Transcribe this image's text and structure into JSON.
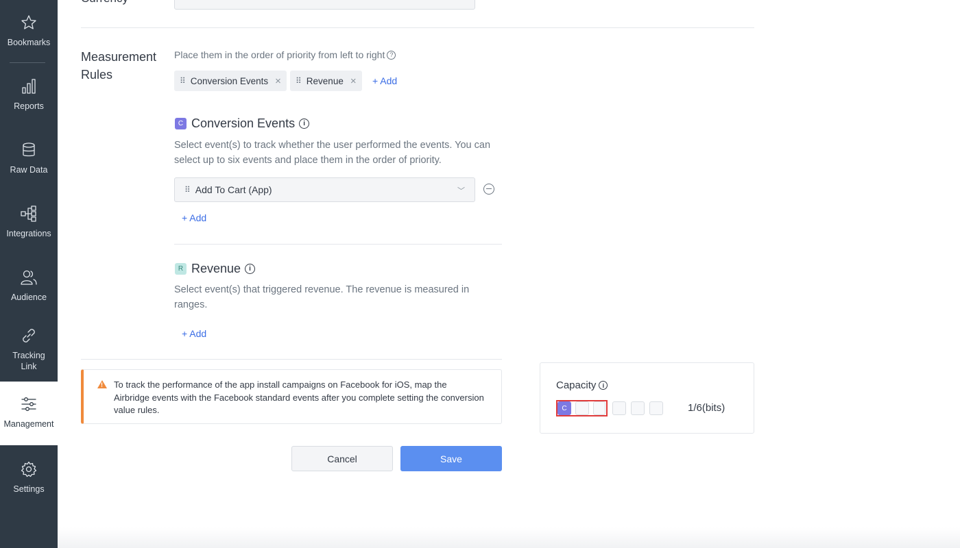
{
  "sidebar": {
    "items": [
      {
        "label": "Bookmarks",
        "icon": "star-icon"
      },
      {
        "label": "Reports",
        "icon": "bar-chart-icon"
      },
      {
        "label": "Raw Data",
        "icon": "database-icon"
      },
      {
        "label": "Integrations",
        "icon": "integrations-icon"
      },
      {
        "label": "Audience",
        "icon": "audience-icon"
      },
      {
        "label": "Tracking\nLink",
        "icon": "link-icon"
      },
      {
        "label": "Management",
        "icon": "sliders-icon",
        "active": true
      },
      {
        "label": "Settings",
        "icon": "gear-icon"
      }
    ]
  },
  "currency": {
    "label": "Currency"
  },
  "measurement": {
    "title": "Measurement Rules",
    "hint": "Place them in the order of  priority from left to right",
    "chips": [
      {
        "label": "Conversion Events"
      },
      {
        "label": "Revenue"
      }
    ],
    "add_label": "+ Add"
  },
  "conversion_events": {
    "badge": "C",
    "title": "Conversion Events",
    "description": "Select event(s) to track whether the user performed the events. You can select up to six events and place them in the order of priority.",
    "selected_event": "Add To Cart (App)",
    "add_label": "+ Add"
  },
  "revenue": {
    "badge": "R",
    "title": "Revenue",
    "description": "Select event(s) that triggered revenue. The revenue is measured in ranges.",
    "add_label": "+ Add"
  },
  "alert": {
    "text": "To track the performance of the app install campaigns on Facebook for iOS, map the Airbridge events with the Facebook standard events after you complete setting the conversion value rules."
  },
  "buttons": {
    "cancel": "Cancel",
    "save": "Save"
  },
  "capacity": {
    "title": "Capacity",
    "used_bits": 1,
    "total_bits": 6,
    "filled_label": "C",
    "count_text": "1/6(bits)"
  },
  "colors": {
    "sidebar_bg": "#2f3a45",
    "accent": "#3b6de5",
    "save_button": "#5b8ff0",
    "conversion_badge": "#7d79e3",
    "revenue_badge": "#bfe7e3",
    "warning": "#f08a3c",
    "highlight": "#e03a3a"
  }
}
